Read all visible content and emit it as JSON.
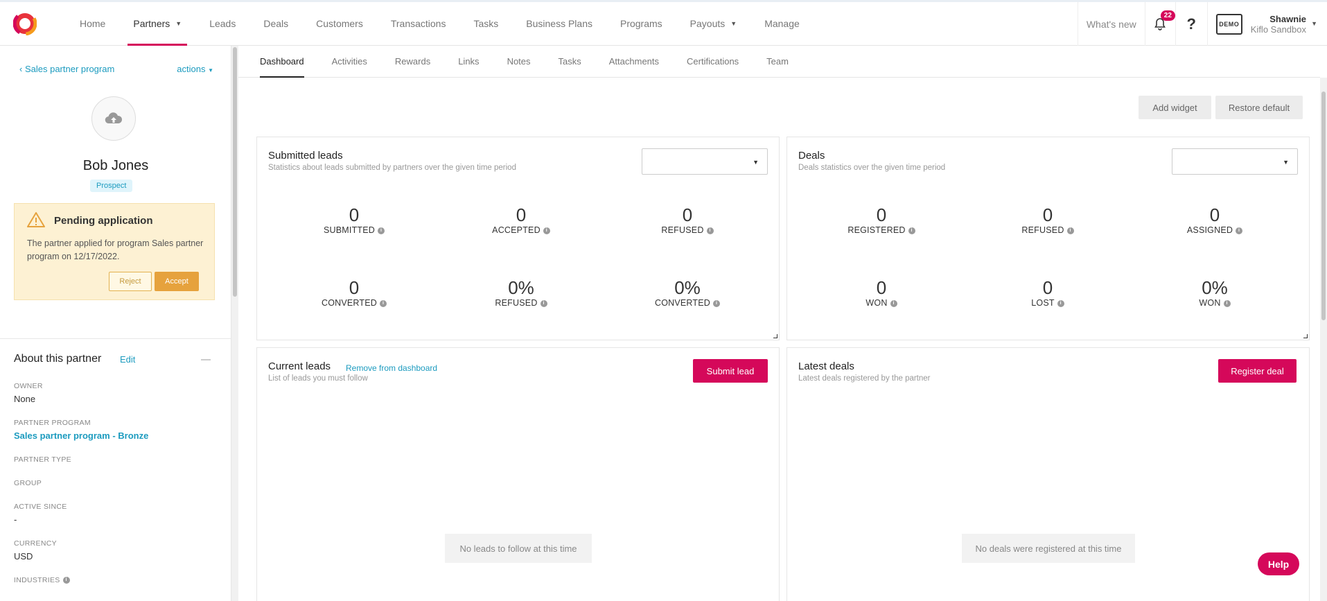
{
  "nav": {
    "items": [
      {
        "label": "Home"
      },
      {
        "label": "Partners"
      },
      {
        "label": "Leads"
      },
      {
        "label": "Deals"
      },
      {
        "label": "Customers"
      },
      {
        "label": "Transactions"
      },
      {
        "label": "Tasks"
      },
      {
        "label": "Business Plans"
      },
      {
        "label": "Programs"
      },
      {
        "label": "Payouts"
      },
      {
        "label": "Manage"
      }
    ],
    "whats_new": "What's new",
    "notification_count": "22",
    "help_icon": "?",
    "demo_label": "DEMO",
    "user_name": "Shawnie",
    "user_org": "Kiflo Sandbox"
  },
  "sidebar": {
    "back_link": "Sales partner program",
    "actions": "actions",
    "partner_name": "Bob Jones",
    "status_badge": "Prospect",
    "pending": {
      "title": "Pending application",
      "text": "The partner applied for program Sales partner program on 12/17/2022.",
      "reject": "Reject",
      "accept": "Accept"
    },
    "about": {
      "title": "About this partner",
      "edit": "Edit",
      "fields": {
        "owner_label": "OWNER",
        "owner_value": "None",
        "program_label": "PARTNER PROGRAM",
        "program_value": "Sales partner program - Bronze",
        "type_label": "PARTNER TYPE",
        "group_label": "GROUP",
        "active_label": "ACTIVE SINCE",
        "active_value": "-",
        "currency_label": "CURRENCY",
        "currency_value": "USD",
        "industries_label": "INDUSTRIES"
      }
    }
  },
  "tabs": [
    {
      "label": "Dashboard"
    },
    {
      "label": "Activities"
    },
    {
      "label": "Rewards"
    },
    {
      "label": "Links"
    },
    {
      "label": "Notes"
    },
    {
      "label": "Tasks"
    },
    {
      "label": "Attachments"
    },
    {
      "label": "Certifications"
    },
    {
      "label": "Team"
    }
  ],
  "toolbar": {
    "add_widget": "Add widget",
    "restore_default": "Restore default"
  },
  "submitted_leads": {
    "title": "Submitted leads",
    "subtitle": "Statistics about leads submitted by partners over the given time period",
    "stats": [
      {
        "value": "0",
        "label": "SUBMITTED"
      },
      {
        "value": "0",
        "label": "ACCEPTED"
      },
      {
        "value": "0",
        "label": "REFUSED"
      },
      {
        "value": "0",
        "label": "CONVERTED"
      },
      {
        "value": "0%",
        "label": "REFUSED"
      },
      {
        "value": "0%",
        "label": "CONVERTED"
      }
    ]
  },
  "deals": {
    "title": "Deals",
    "subtitle": "Deals statistics over the given time period",
    "stats": [
      {
        "value": "0",
        "label": "REGISTERED"
      },
      {
        "value": "0",
        "label": "REFUSED"
      },
      {
        "value": "0",
        "label": "ASSIGNED"
      },
      {
        "value": "0",
        "label": "WON"
      },
      {
        "value": "0",
        "label": "LOST"
      },
      {
        "value": "0%",
        "label": "WON"
      }
    ]
  },
  "current_leads": {
    "title": "Current leads",
    "remove_link": "Remove from dashboard",
    "subtitle": "List of leads you must follow",
    "button": "Submit lead",
    "empty": "No leads to follow at this time"
  },
  "latest_deals": {
    "title": "Latest deals",
    "subtitle": "Latest deals registered by the partner",
    "button": "Register deal",
    "empty": "No deals were registered at this time"
  },
  "help_button": "Help"
}
